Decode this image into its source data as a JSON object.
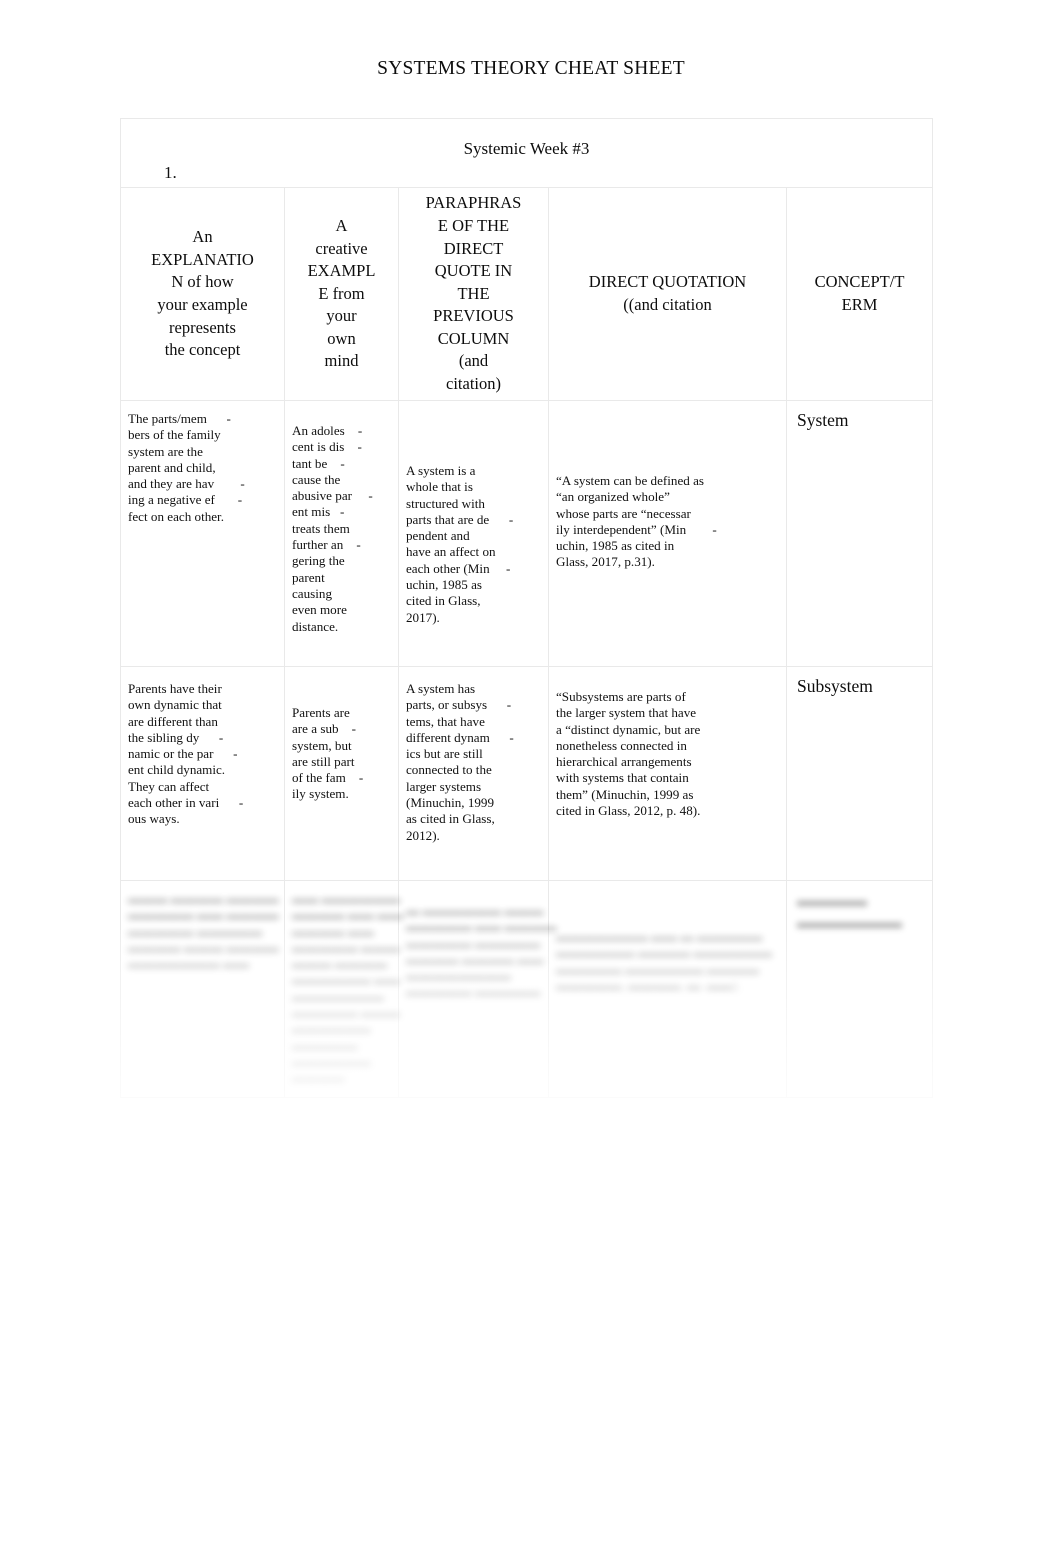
{
  "document": {
    "title": "SYSTEMS THEORY CHEAT SHEET"
  },
  "table": {
    "caption": "Systemic Week #3",
    "list_number": "1.",
    "headers": [
      {
        "name": "explanation",
        "lines": [
          "An",
          "EXPLANATIO",
          "N of how",
          "your example",
          "represents",
          "the concept"
        ]
      },
      {
        "name": "example",
        "lines": [
          "A",
          "creative",
          "EXAMPL",
          "E from",
          "your",
          "own",
          "mind"
        ]
      },
      {
        "name": "paraphrase",
        "lines": [
          "PARAPHRAS",
          "E OF THE",
          "DIRECT",
          "QUOTE IN",
          "THE",
          "PREVIOUS",
          "COLUMN",
          "(and",
          "citation)"
        ]
      },
      {
        "name": "direct-quotation",
        "lines": [
          "DIRECT QUOTATION",
          "((and citation"
        ]
      },
      {
        "name": "concept-term",
        "lines": [
          "CONCEPT/T",
          "ERM"
        ]
      }
    ],
    "rows": [
      {
        "term": "System",
        "blurred": false,
        "explanation": [
          "The parts/mem      -",
          "bers of the family",
          "system are the",
          "parent and child,",
          "and they are hav        -",
          "ing a negative ef       -",
          "fect on each other."
        ],
        "example": [
          "An adoles    -",
          "cent is dis    -",
          "tant be    -",
          "cause the",
          "abusive par     -",
          "ent mis   -",
          "treats them",
          "further an    -",
          "gering the",
          "parent",
          "causing",
          "even more",
          "distance."
        ],
        "paraphrase": [
          "A system is a",
          "whole that is",
          "structured with",
          "parts that are de      -",
          "pendent and",
          "have an affect on",
          "each other (Min     -",
          "uchin, 1985 as",
          "cited in Glass,",
          "2017)."
        ],
        "quotation": [
          "“A system can be defined as",
          "“an organized whole”",
          "whose parts are “necessar",
          "ily interdependent” (Min        -",
          "uchin, 1985 as cited in",
          "Glass, 2017, p.31)."
        ]
      },
      {
        "term": "Subsystem",
        "blurred": false,
        "explanation": [
          "Parents have their",
          "own dynamic that",
          "are different than",
          "the sibling dy      -",
          "namic or the par      -",
          "ent child dynamic.",
          "They can affect",
          "each other in vari      -",
          "ous ways."
        ],
        "example": [
          "Parents are",
          "are a sub    -",
          "system, but",
          "are still part",
          "of the fam    -",
          "ily system."
        ],
        "paraphrase": [
          "A system has",
          "parts, or subsys      -",
          "tems, that have",
          "different dynam      -",
          "ics but are still",
          "connected to the",
          "larger systems",
          "(Minuchin, 1999",
          "as cited in Glass,",
          "2012)."
        ],
        "quotation": [
          "“Subsystems are parts of",
          "the larger system that have",
          "a “distinct dynamic, but are",
          "nonetheless connected in",
          "hierarchical arrangements",
          "with systems that contain",
          "them” (Minuchin, 1999 as",
          "cited in Glass, 2012, p. 48)."
        ]
      },
      {
        "term": "▬▬▬▬\n▬▬▬▬▬▬",
        "blurred": true,
        "explanation": [
          "▬▬▬ ▬▬▬▬ ▬▬▬▬",
          "▬▬▬▬▬ ▬▬ ▬▬▬▬",
          "▬▬▬▬▬ ▬▬▬▬▬",
          "▬▬▬▬ ▬▬▬ ▬▬▬▬",
          "▬▬▬▬▬▬▬ ▬▬"
        ],
        "example": [
          "▬▬ ▬▬▬▬▬▬",
          "▬▬▬▬ ▬▬ ▬▬",
          "▬▬▬▬ ▬▬",
          "▬▬▬▬▬ ▬▬▬",
          "▬▬▬ ▬▬▬▬",
          "▬▬▬▬▬▬ ▬▬",
          "▬▬▬▬▬▬▬",
          "▬▬▬▬▬ ▬▬▬",
          "▬▬▬▬▬▬",
          "▬▬▬▬▬",
          "▬▬▬▬▬▬",
          "▬▬▬▬"
        ],
        "paraphrase": [
          "▬ ▬▬▬▬▬▬ ▬▬▬",
          "▬▬▬▬▬ ▬▬ ▬▬▬▬",
          "▬▬▬▬▬ ▬▬▬▬▬",
          "▬▬▬▬ ▬▬▬▬ ▬▬",
          "▬▬▬▬▬▬▬▬",
          "▬▬▬▬▬ ▬▬▬▬▬"
        ],
        "quotation": [
          "▬▬▬▬▬▬▬ ▬▬ ▬ ▬▬▬▬▬",
          "▬▬▬▬▬▬ ▬▬▬▬ ▬▬▬▬▬▬",
          "▬▬▬▬▬ ▬▬▬▬▬▬ ▬▬▬▬",
          "▬▬▬▬▬, ▬▬▬▬, ▬. ▬▬)."
        ]
      }
    ]
  }
}
